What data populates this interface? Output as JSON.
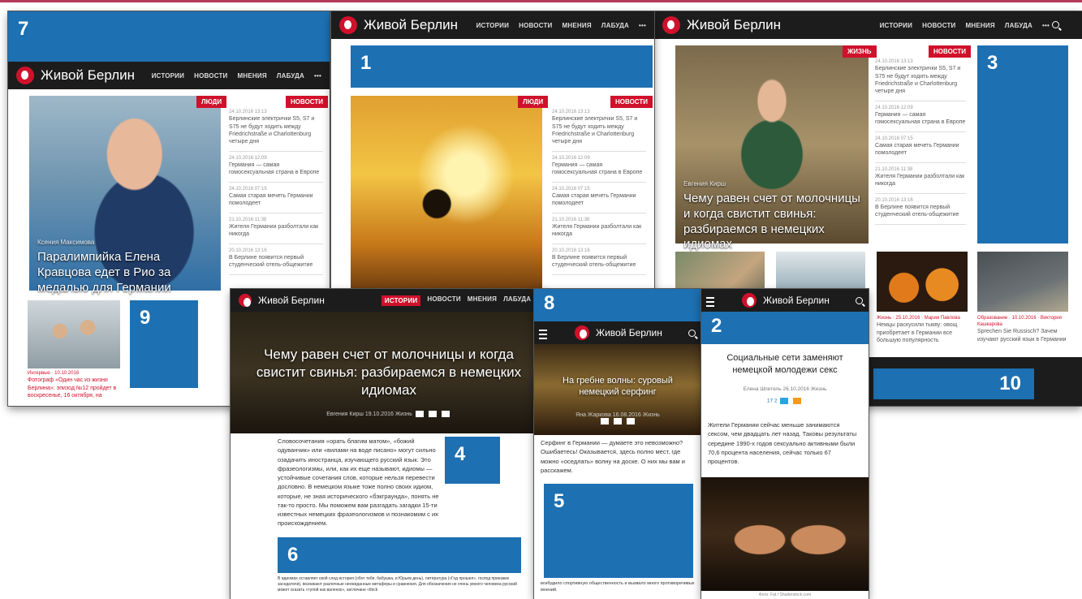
{
  "brand": "Живой Берлин",
  "nav": [
    "ИСТОРИИ",
    "НОВОСТИ",
    "МНЕНИЯ",
    "ЛАБУДА",
    "•••"
  ],
  "numbers": {
    "n1": "1",
    "n2": "2",
    "n3": "3",
    "n4": "4",
    "n5": "5",
    "n6": "6",
    "n7": "7",
    "n8": "8",
    "n9": "9",
    "n10": "10"
  },
  "tags": {
    "people": "ЛЮДИ",
    "news": "НОВОСТИ",
    "life": "ЖИЗНЬ"
  },
  "sidebar": [
    {
      "date": "24.10.2016 13:13",
      "text": "Берлинские электрички S5, S7 и S75 не будут ходить между Friedrichstraße и Charlottenburg четыре дня"
    },
    {
      "date": "24.10.2016 12:09",
      "text": "Германия — самая гомосексуальная страна в Европе"
    },
    {
      "date": "24.10.2016 07:15",
      "text": "Самая старая мечеть Германии помолодеет"
    },
    {
      "date": "21.10.2016 11:38",
      "text": "Жителя Германии разболтали как никогда"
    },
    {
      "date": "20.10.2016 13:16",
      "text": "В Берлине появится первый студенческий отель-общежитие"
    }
  ],
  "shot7": {
    "author": "Ксения Максимова",
    "headline": "Паралимпийка Елена Кравцова едет в Рио за медалью для Германии",
    "small_date": "Интервью · 10.10.2016",
    "small_text": "Фотограф «Один час из жизни Берлина»: эпизод №12 пройдет в воскресенье, 16 октября, на"
  },
  "shot3": {
    "author": "Евгения Кирш",
    "headline": "Чему равен счет от молочницы и когда свистит свинья: разбираемся в немецких идиомах",
    "card1": "Немцы раскусили тыкву: овощ приобретает в Германии все большую популярность",
    "card1_meta": "Жизнь · 25.10.2016 · Мария Павлова",
    "card2": "Sprechen Sie Russisch? Зачем изучают русский язык в Германии",
    "card2_meta": "Образование · 10.10.2016 · Виктория Кашкарова"
  },
  "article4": {
    "title": "Чему равен счет от молочницы и когда свистит свинья: разбираемся в немецких идиомах",
    "meta": "Евгения Кирш   19.10.2016   Жизнь",
    "body": "Словосочетания «орать благим матом», «божий одуванчик» или «вилами на воде писано» могут сильно озадачить иностранца, изучающего русский язык. Это фразеологизмы, или, как их еще называют, идиомы — устойчивые сочетания слов, которые нельзя перевести дословно. В немецком языке тоже полно своих идиом, которые, не зная исторического «бэкграунда», понять не так-то просто. Мы поможем вам разгадать загадки 15-ти известных немецких фразеологизмов и познакомим с их происхождением.",
    "foot": "В идиомах оставляет свой след история (обот тебя, бабушка, и Юрьев день), литература («Год прошел», господ приезжих заседатели), возникают различные неожиданные метафоры и сравнения. Для обозначения не очень умного человека русский может сказать «тупой как валенок», англичане «thick"
  },
  "article8": {
    "title": "На гребне волны: суровый немецкий серфинг",
    "meta": "Яна Жаркова   16.08.2016   Жизнь",
    "body": "Серфинг в Германии — думаете это невозможно? Ошибаетесь! Оказывается, здесь полно мест, где можно «оседлать» волну на доске. О них мы вам и расскажем.",
    "foot": "возбудило спортивную общественность и вызвало много противоречивых мнений."
  },
  "article2": {
    "title": "Социальные сети заменяют немецкой молодежи секс",
    "meta": "Елена Шпетель   26.10.2016   Жизнь",
    "share": "17  2",
    "body": "Жители Германии сейчас меньше занимаются сексом, чем двадцать лет назад. Таковы результаты середине 1990-х годов сексуально активными были 70,6 процента населения, сейчас только 67 процентов.",
    "photo_credit": "Фото: Fat / Shutterstock.com"
  },
  "colors": {
    "accent": "#d0112b",
    "ad_blue": "#1d70b2",
    "header": "#1c1c1c"
  }
}
